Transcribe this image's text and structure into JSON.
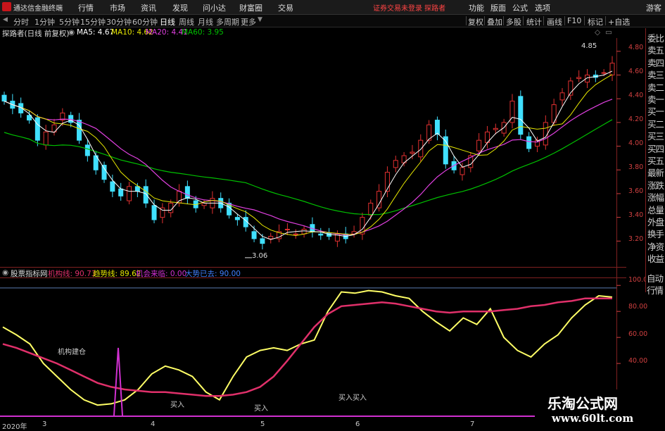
{
  "titlebar": {
    "app_name": "通达信金融终端",
    "menus": [
      "行情",
      "市场",
      "资讯",
      "发现",
      "问小达",
      "财富圈",
      "交易"
    ],
    "notice": "证券交易未登录  探路者",
    "right_menus": [
      "功能",
      "版面",
      "公式",
      "选项"
    ],
    "guest": "游客"
  },
  "toolbar": {
    "periods": [
      "分时",
      "1分钟",
      "5分钟",
      "15分钟",
      "30分钟",
      "60分钟",
      "日线",
      "周线",
      "月线",
      "多周期",
      "更多"
    ],
    "active_period": "日线",
    "buttons": [
      "复权",
      "叠加",
      "多股",
      "统计",
      "画线",
      "F10",
      "标记",
      "+自选"
    ]
  },
  "price_legend": {
    "name": "探路者(日线 前复权)",
    "ma5": "MA5: 4.67",
    "ma10": "MA10: 4.62",
    "ma20": "MA20: 4.41",
    "ma60": "MA60: 3.95"
  },
  "colors": {
    "up": "#e03030",
    "down": "#40e0ff",
    "ma5": "#ffffff",
    "ma10": "#e6e600",
    "ma20": "#e040e0",
    "ma60": "#00c000",
    "line_yellow": "#ffff66",
    "line_red": "#e0306a",
    "line_magenta": "#d030d0",
    "axis": "#d04040"
  },
  "price_axis": [
    "4.80",
    "4.60",
    "4.40",
    "4.20",
    "4.00",
    "3.80",
    "3.60",
    "3.40",
    "3.20"
  ],
  "price_marks": {
    "high": "4.85",
    "low": "3.06"
  },
  "right_panel": [
    "委比",
    "卖五",
    "卖四",
    "卖三",
    "卖二",
    "卖一",
    "买一",
    "买二",
    "买三",
    "买四",
    "买五",
    "最新",
    "涨跌",
    "涨幅",
    "总量",
    "外盘",
    "换手",
    "净资",
    "收益"
  ],
  "right_panel_bottom": [
    "自动",
    "行情"
  ],
  "indicator_legend": {
    "name": "股票指标网",
    "institution": "机构线: 90.73",
    "trend": "趋势线: 89.62",
    "opportunity": "机会来临: 0.00",
    "gone": "大势已去: 90.00"
  },
  "indicator_axis": [
    "100.0",
    "80.00",
    "60.00",
    "40.00"
  ],
  "annotations": [
    "机构建仓",
    "买入",
    "买入",
    "买入买入"
  ],
  "x_labels": [
    "2020年",
    "3",
    "4",
    "5",
    "6",
    "7"
  ],
  "watermark": {
    "line1": "乐淘公式网",
    "line2": "www.60lt.com"
  },
  "chart_data": {
    "type": "candlestick+line",
    "price_ylim": [
      3.0,
      4.9
    ],
    "price_axis_ticks": [
      3.2,
      3.4,
      3.6,
      3.8,
      4.0,
      4.2,
      4.4,
      4.6,
      4.8
    ],
    "high": 4.85,
    "low": 3.06,
    "close": [
      4.38,
      4.32,
      4.28,
      4.22,
      4.05,
      4.12,
      4.18,
      4.28,
      4.2,
      4.05,
      3.92,
      3.8,
      3.72,
      3.62,
      3.58,
      3.66,
      3.62,
      3.52,
      3.38,
      3.48,
      3.52,
      3.62,
      3.56,
      3.48,
      3.52,
      3.56,
      3.48,
      3.42,
      3.38,
      3.32,
      3.22,
      3.18,
      3.24,
      3.28,
      3.3,
      3.26,
      3.3,
      3.28,
      3.25,
      3.24,
      3.26,
      3.22,
      3.28,
      3.4,
      3.52,
      3.62,
      3.78,
      3.88,
      3.92,
      3.95,
      4.05,
      4.18,
      4.1,
      3.85,
      3.8,
      3.82,
      3.92,
      4.05,
      4.12,
      4.15,
      4.2,
      4.38,
      4.1,
      3.98,
      4.05,
      4.2,
      4.35,
      4.45,
      4.55,
      4.58,
      4.6,
      4.58,
      4.62,
      4.7
    ],
    "ma5_last": 4.67,
    "ma10_last": 4.62,
    "ma20_last": 4.41,
    "ma60_last": 3.95,
    "indicator_ylim": [
      0,
      105
    ],
    "indicator_axis_ticks": [
      40,
      60,
      80,
      100
    ],
    "series": [
      {
        "name": "机构线",
        "last": 90.73,
        "values": [
          68,
          62,
          55,
          40,
          30,
          20,
          12,
          8,
          9,
          12,
          20,
          32,
          38,
          35,
          30,
          18,
          12,
          30,
          45,
          50,
          52,
          50,
          55,
          58,
          80,
          95,
          94,
          96,
          95,
          92,
          90,
          80,
          72,
          65,
          75,
          70,
          82,
          60,
          50,
          45,
          55,
          62,
          75,
          85,
          92,
          91
        ]
      },
      {
        "name": "趋势线",
        "last": 89.62,
        "values": [
          55,
          52,
          48,
          44,
          40,
          35,
          30,
          25,
          22,
          20,
          19,
          18,
          18,
          17,
          16,
          15,
          15,
          16,
          18,
          22,
          30,
          42,
          55,
          68,
          78,
          84,
          85,
          86,
          87,
          86,
          84,
          82,
          80,
          79,
          80,
          80,
          80,
          81,
          82,
          84,
          85,
          87,
          88,
          90,
          90,
          90
        ]
      },
      {
        "name": "机会来临",
        "last": 0.0
      },
      {
        "name": "大势已去",
        "last": 90.0
      }
    ],
    "x_labels": [
      "2020年",
      "3",
      "4",
      "5",
      "6",
      "7"
    ]
  }
}
